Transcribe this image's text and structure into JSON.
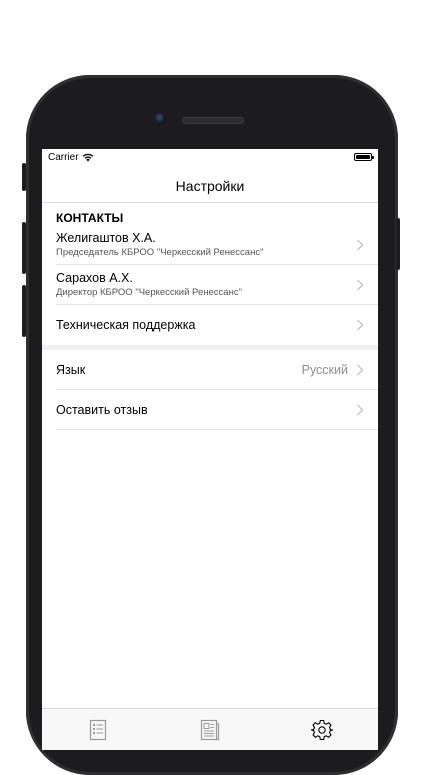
{
  "status_bar": {
    "carrier": "Carrier"
  },
  "nav": {
    "title": "Настройки"
  },
  "contacts": {
    "header": "КОНТАКТЫ",
    "items": [
      {
        "name": "Желигаштов Х.А.",
        "role": "Председатель КБРОО \"Черкесский Ренессанс\""
      },
      {
        "name": "Сарахов А.Х.",
        "role": "Директор КБРОО \"Черкесский Ренессанс\""
      }
    ],
    "support": "Техническая поддержка"
  },
  "settings": {
    "language_label": "Язык",
    "language_value": "Русский",
    "feedback_label": "Оставить отзыв"
  },
  "tabbar": {
    "tabs": [
      {
        "icon": "document-list-icon",
        "selected": false
      },
      {
        "icon": "newspaper-icon",
        "selected": false
      },
      {
        "icon": "gear-icon",
        "selected": true
      }
    ]
  }
}
